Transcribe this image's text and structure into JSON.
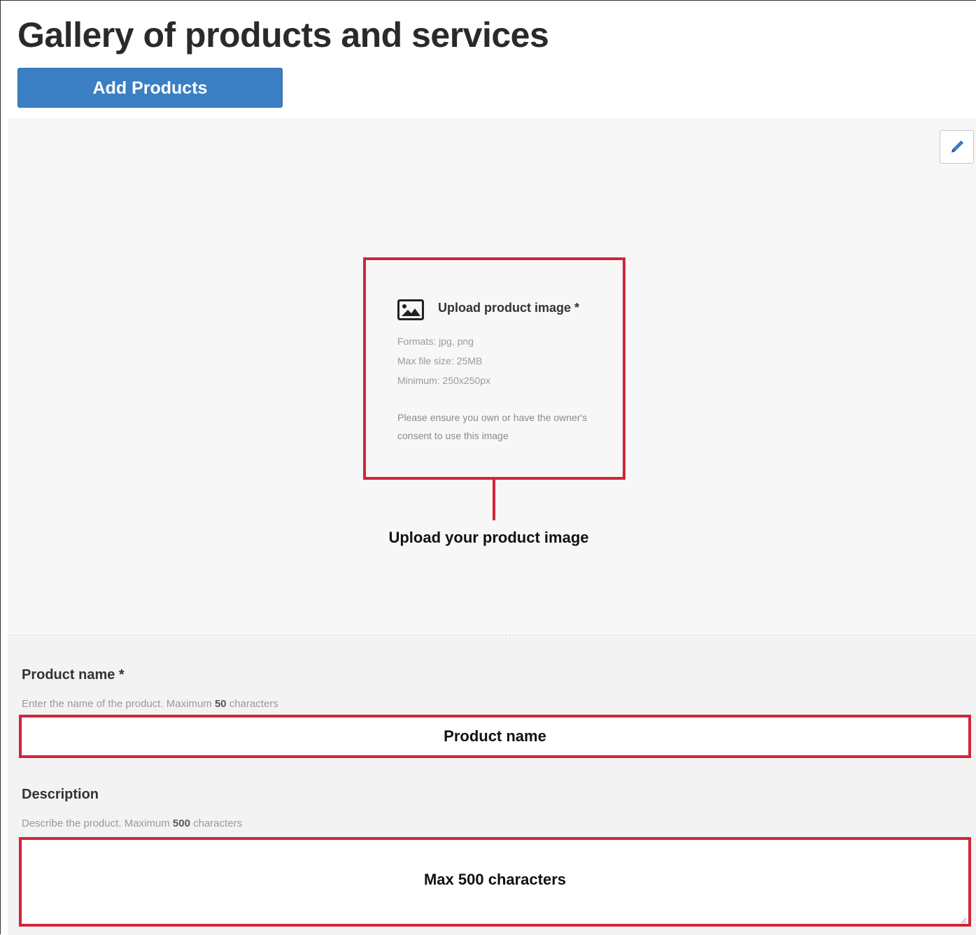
{
  "header": {
    "title": "Gallery of products and services",
    "add_button_label": "Add Products"
  },
  "upload": {
    "edit_icon": "pencil-icon",
    "image_icon": "image-icon",
    "heading": "Upload product image *",
    "formats": "Formats: jpg, png",
    "max_size": "Max file size: 25MB",
    "minimum": "Minimum: 250x250px",
    "consent": "Please ensure you own or have the owner's consent to use this image",
    "callout": "Upload your product image"
  },
  "form": {
    "product_name": {
      "label": "Product name *",
      "hint_prefix": "Enter the name of the product. Maximum ",
      "hint_limit": "50",
      "hint_suffix": " characters",
      "placeholder": "Product name"
    },
    "description": {
      "label": "Description",
      "hint_prefix": "Describe the product. Maximum ",
      "hint_limit": "500",
      "hint_suffix": " characters",
      "placeholder": "Max 500 characters"
    }
  },
  "colors": {
    "accent_blue": "#3a7fc3",
    "highlight_red": "#d0263a",
    "upload_bg": "#f7f7f7",
    "form_bg": "#f3f3f3"
  }
}
